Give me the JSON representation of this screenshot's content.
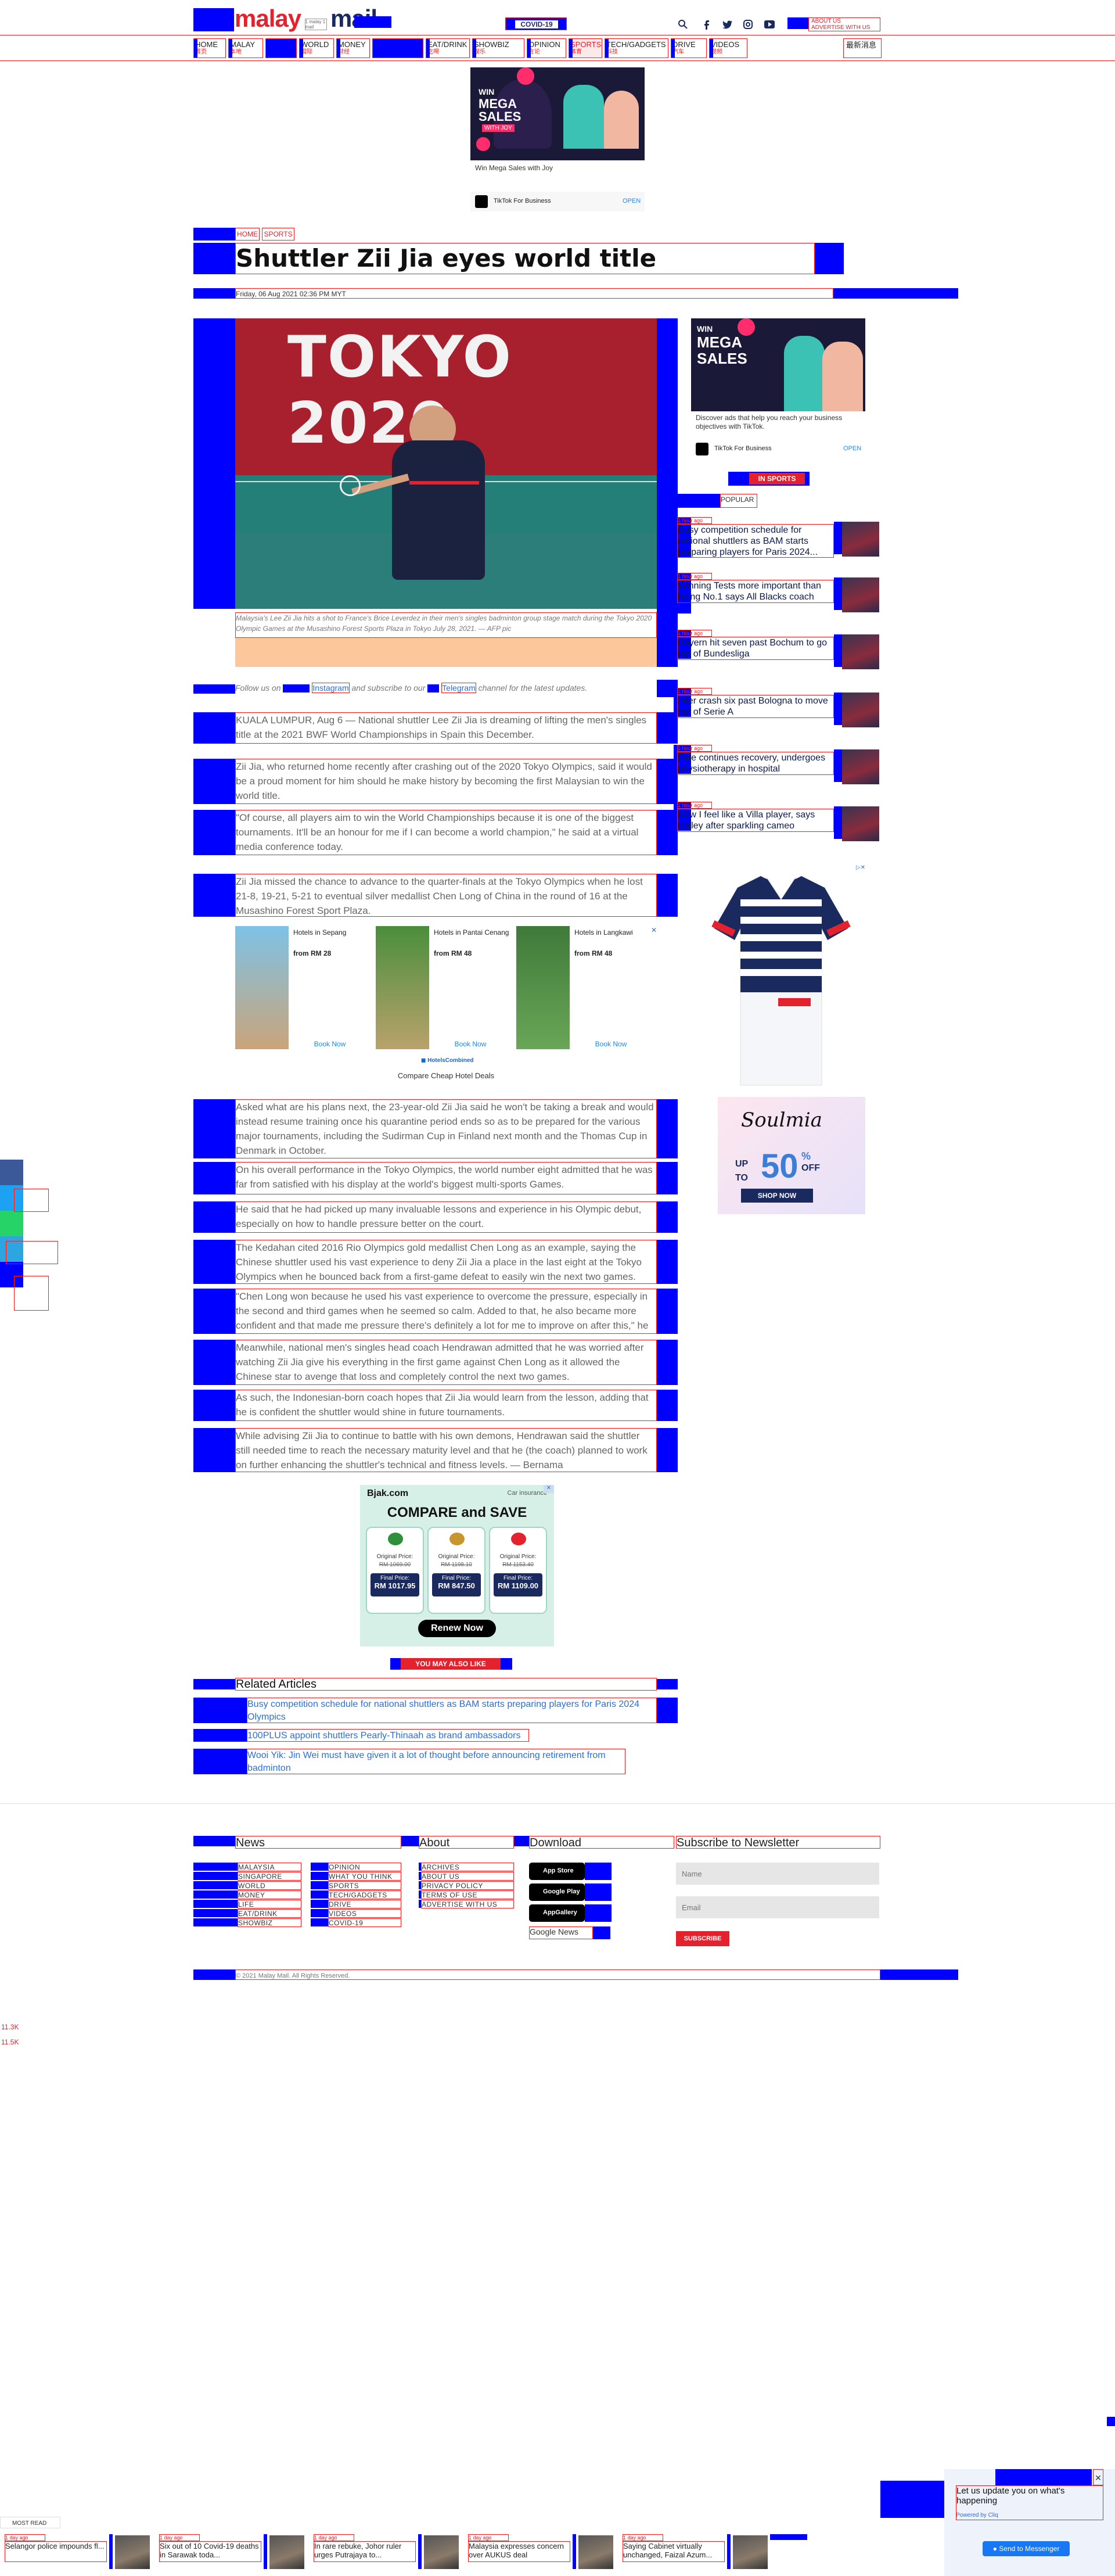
{
  "header": {
    "logo_left": "malay",
    "logo_right": "mail",
    "logo_tag": "1 malay 1 mail",
    "covid_label": "COVID-19",
    "advertise_label": "ABOUT US",
    "advertise_sub": "ADVERTISE WITH US",
    "social_icons": [
      "search-icon",
      "facebook-icon",
      "twitter-icon",
      "instagram-icon",
      "youtube-icon"
    ]
  },
  "nav": {
    "items": [
      {
        "label": "HOME",
        "sub": "首页"
      },
      {
        "label": "MALAY",
        "sub": "本地"
      },
      {
        "label": "",
        "sub": ""
      },
      {
        "label": "WORLD",
        "sub": "国际"
      },
      {
        "label": "MONEY",
        "sub": "财经"
      },
      {
        "label": "",
        "sub": ""
      },
      {
        "label": "EAT/DRINK",
        "sub": "吃喝"
      },
      {
        "label": "SHOWBIZ",
        "sub": "娱乐"
      },
      {
        "label": "OPINION",
        "sub": "言论"
      },
      {
        "label": "SPORTS",
        "sub": "体育"
      },
      {
        "label": "TECH/GADGETS",
        "sub": "科技"
      },
      {
        "label": "DRIVE",
        "sub": "汽车"
      },
      {
        "label": "VIDEOS",
        "sub": "视频"
      }
    ],
    "chinese_label": "最新消息"
  },
  "top_ad": {
    "caption": "Win Mega Sales with Joy",
    "brand": "TikTok For Business",
    "cta": "OPEN",
    "ad_text_1": "WIN",
    "ad_text_2": "MEGA",
    "ad_text_3": "SALES",
    "ad_text_4": "WITH JOY"
  },
  "breadcrumb": {
    "home": "HOME",
    "section": "SPORTS"
  },
  "article": {
    "title": "Shuttler Zii Jia eyes world title",
    "date": "Friday, 06 Aug 2021 02:36 PM MYT",
    "image_text": "TOKYO 2020",
    "caption": "Malaysia's Lee Zii Jia hits a shot to France's Brice Leverdez in their men's singles badminton group stage match during the Tokyo 2020 Olympic Games at the Musashino Forest Sports Plaza in Tokyo July 28, 2021. — AFP pic",
    "follow_text_a": "Follow us on",
    "follow_instagram": "Instagram",
    "follow_text_b": "and subscribe to our",
    "follow_telegram": "Telegram",
    "follow_text_c": "channel for the latest updates.",
    "paragraphs_a": [
      "KUALA LUMPUR, Aug 6 — National shuttler Lee Zii Jia is dreaming of lifting the men's singles title at the 2021 BWF World Championships in Spain this December.",
      "Zii Jia, who returned home recently after crashing out of the 2020 Tokyo Olympics, said it would be a proud moment for him should he make history by becoming the first Malaysian to win the world title.",
      "\"Of course, all players aim to win the World Championships because it is one of the biggest tournaments. It'll be an honour for me if I can become a world champion,\" he said at a virtual media conference today.",
      "Zii Jia missed the chance to advance to the quarter-finals at the Tokyo Olympics when he lost 21-8, 19-21, 5-21 to eventual silver medallist Chen Long of China in the round of 16 at the Musashino Forest Sport Plaza."
    ],
    "paragraphs_b": [
      "Asked what are his plans next, the 23-year-old Zii Jia said he won't be taking a break and would instead resume training once his quarantine period ends so as to be prepared for the various major tournaments, including the Sudirman Cup in Finland next month and the Thomas Cup in Denmark in October.",
      "On his overall performance in the Tokyo Olympics, the world number eight admitted that he was far from satisfied with his display at the world's biggest multi-sports Games.",
      "He said that he had picked up many invaluable lessons and experience in his Olympic debut, especially on how to handle pressure better on the court.",
      "The Kedahan cited 2016 Rio Olympics gold medallist Chen Long as an example, saying the Chinese shuttler used his vast experience to deny Zii Jia a place in the last eight at the Tokyo Olympics when he bounced back from a first-game defeat to easily win the next two games.",
      "\"Chen Long won because he used his vast experience to overcome the pressure, especially in the second and third games when he seemed so calm. Added to that, he also became more confident and that made me pressure there's definitely a lot for me to improve on after this,\" he said.",
      "Meanwhile, national men's singles head coach Hendrawan admitted that he was worried after watching Zii Jia give his everything in the first game against Chen Long as it allowed the Chinese star to avenge that loss and completely control the next two games.",
      "As such, the Indonesian-born coach hopes that Zii Jia would learn from the lesson, adding that he is confident the shuttler would shine in future tournaments.",
      "While advising Zii Jia to continue to battle with his own demons, Hendrawan said the shuttler still needed time to reach the necessary maturity level and that he (the coach) planned to work on further enhancing the shuttler's technical and fitness levels. — Bernama"
    ]
  },
  "hotel_ad": {
    "items": [
      {
        "title": "Hotels in Sepang",
        "price": "from RM 28",
        "cta": "Book Now"
      },
      {
        "title": "Hotels in Pantai Cenang",
        "price": "from RM 48",
        "cta": "Book Now"
      },
      {
        "title": "Hotels in Langkawi",
        "price": "from RM 48",
        "cta": "Book Now"
      }
    ],
    "brand": "HotelsCombined",
    "footer": "Compare Cheap Hotel Deals"
  },
  "sidebar": {
    "ad_text": "Discover ads that help you reach your business objectives with TikTok.",
    "ad_brand": "TikTok For Business",
    "ad_cta": "OPEN",
    "in_sports_label": "IN SPORTS",
    "popular_label": "POPULAR",
    "items": [
      {
        "time": "1 hour ago",
        "title": "Busy competition schedule for national shuttlers as BAM starts preparing players for Paris 2024..."
      },
      {
        "time": "1 hour ago",
        "title": "Winning Tests more important than being No.1 says All Blacks coach"
      },
      {
        "time": "1 hour ago",
        "title": "Bayern hit seven past Bochum to go top of Bundesliga"
      },
      {
        "time": "1 hour ago",
        "title": "Inter crash six past Bologna to move top of Serie A"
      },
      {
        "time": "1 hour ago",
        "title": "Pele continues recovery, undergoes physiotherapy in hospital"
      },
      {
        "time": "1 hour ago",
        "title": "Now I feel like a Villa player, says Bailey after sparkling cameo"
      }
    ],
    "shirt_ad": {
      "brand": "Soulmia",
      "up_to": "UP TO",
      "percent": "50",
      "off": "OFF",
      "cta": "SHOP NOW"
    }
  },
  "insurance_ad": {
    "brand": "Bjak.com",
    "tag": "Car insurance",
    "headline": "COMPARE and SAVE",
    "cards": [
      {
        "orig_label": "Original Price:",
        "orig": "RM 1069.00",
        "final_label": "Final Price:",
        "final": "RM 1017.95"
      },
      {
        "orig_label": "Original Price:",
        "orig": "RM 1198.10",
        "final_label": "Final Price:",
        "final": "RM 847.50"
      },
      {
        "orig_label": "Original Price:",
        "orig": "RM 1153.40",
        "final_label": "Final Price:",
        "final": "RM 1109.00"
      }
    ],
    "cta": "Renew Now"
  },
  "related": {
    "you_may_like": "YOU MAY ALSO LIKE",
    "heading": "Related Articles",
    "links": [
      "Busy competition schedule for national shuttlers as BAM starts preparing players for Paris 2024 Olympics",
      "100PLUS appoint shuttlers Pearly-Thinaah as brand ambassadors",
      "Wooi Yik: Jin Wei must have given it a lot of thought before announcing retirement from badminton"
    ]
  },
  "footer": {
    "news_heading": "News",
    "about_heading": "About",
    "download_heading": "Download",
    "subscribe_heading": "Subscribe to Newsletter",
    "news_col1": [
      "MALAYSIA",
      "SINGAPORE",
      "WORLD",
      "MONEY",
      "LIFE",
      "EAT/DRINK",
      "SHOWBIZ"
    ],
    "news_col2": [
      "OPINION",
      "WHAT YOU THINK",
      "SPORTS",
      "TECH/GADGETS",
      "DRIVE",
      "VIDEOS",
      "COVID-19"
    ],
    "about_links": [
      "ARCHIVES",
      "ABOUT US",
      "PRIVACY POLICY",
      "TERMS OF USE",
      "ADVERTISE WITH US"
    ],
    "store_badges": [
      "App Store",
      "Google Play",
      "AppGallery"
    ],
    "google_news": "Google News",
    "name_placeholder": "Name",
    "email_placeholder": "Email",
    "subscribe_button": "SUBSCRIBE",
    "copyright": "© 2021 Malay Mail. All Rights Reserved."
  },
  "left_share": {
    "counts": [
      "11.3K",
      "11.5K"
    ]
  },
  "most_read": {
    "label": "MOST READ",
    "items": [
      {
        "time": "1 day ago",
        "title": "Selangor police impounds fl..."
      },
      {
        "time": "1 day ago",
        "title": "Six out of 10 Covid-19 deaths in Sarawak toda..."
      },
      {
        "time": "1 day ago",
        "title": "In rare rebuke, Johor ruler urges Putrajaya to..."
      },
      {
        "time": "1 day ago",
        "title": "Malaysia expresses concern over AUKUS deal"
      },
      {
        "time": "1 day ago",
        "title": "Saying Cabinet virtually unchanged, Faizal Azum..."
      }
    ]
  },
  "messenger": {
    "text": "Let us update you on what's happening",
    "sub": "Powered by Cliq",
    "button": "Send to Messenger"
  },
  "colors": {
    "brand_red": "#e4222e",
    "brand_navy": "#1b2a5e",
    "overlay_blue": "#0000ff"
  }
}
